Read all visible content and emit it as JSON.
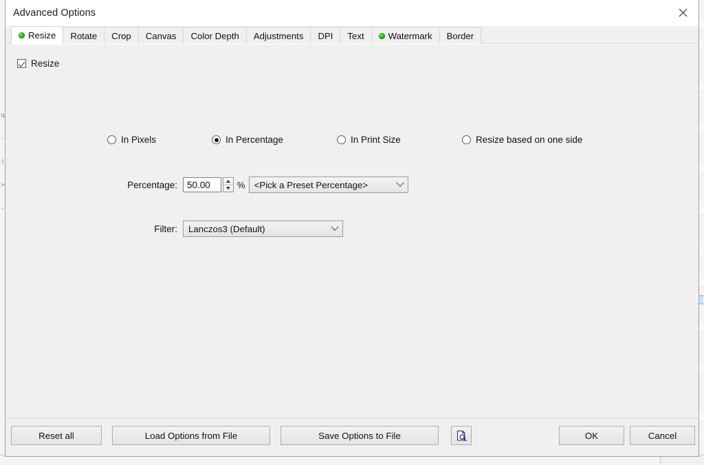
{
  "window": {
    "title": "Advanced Options",
    "close_icon": "close-icon"
  },
  "tabs": [
    {
      "label": "Resize",
      "active": true,
      "has_dot": true
    },
    {
      "label": "Rotate",
      "active": false,
      "has_dot": false
    },
    {
      "label": "Crop",
      "active": false,
      "has_dot": false
    },
    {
      "label": "Canvas",
      "active": false,
      "has_dot": false
    },
    {
      "label": "Color Depth",
      "active": false,
      "has_dot": false
    },
    {
      "label": "Adjustments",
      "active": false,
      "has_dot": false
    },
    {
      "label": "DPI",
      "active": false,
      "has_dot": false
    },
    {
      "label": "Text",
      "active": false,
      "has_dot": false
    },
    {
      "label": "Watermark",
      "active": false,
      "has_dot": true
    },
    {
      "label": "Border",
      "active": false,
      "has_dot": false
    }
  ],
  "panel": {
    "enable_checkbox": {
      "label": "Resize",
      "checked": true
    },
    "mode_radios": [
      {
        "label": "In Pixels",
        "selected": false
      },
      {
        "label": "In Percentage",
        "selected": true
      },
      {
        "label": "In Print Size",
        "selected": false
      },
      {
        "label": "Resize based on one side",
        "selected": false
      }
    ],
    "percentage": {
      "label": "Percentage:",
      "value": "50.00",
      "unit": "%",
      "spinner_up_icon": "chevron-up-icon",
      "spinner_down_icon": "chevron-down-icon",
      "preset_combo": {
        "value": "<Pick a Preset Percentage>",
        "chevron_icon": "chevron-down-icon"
      }
    },
    "filter": {
      "label": "Filter:",
      "value": "Lanczos3 (Default)",
      "chevron_icon": "chevron-down-icon"
    }
  },
  "footer": {
    "reset_all": "Reset all",
    "load_options": "Load Options from File",
    "save_options": "Save Options to File",
    "preview_icon": "document-magnifier-icon",
    "ok": "OK",
    "cancel": "Cancel"
  },
  "colors": {
    "dialog_bg": "#f0f0f0",
    "tab_active_bg": "#ffffff",
    "status_dot_green": "#2fbe23",
    "preview_icon_blue": "#2a2a8c",
    "text": "#111111"
  }
}
